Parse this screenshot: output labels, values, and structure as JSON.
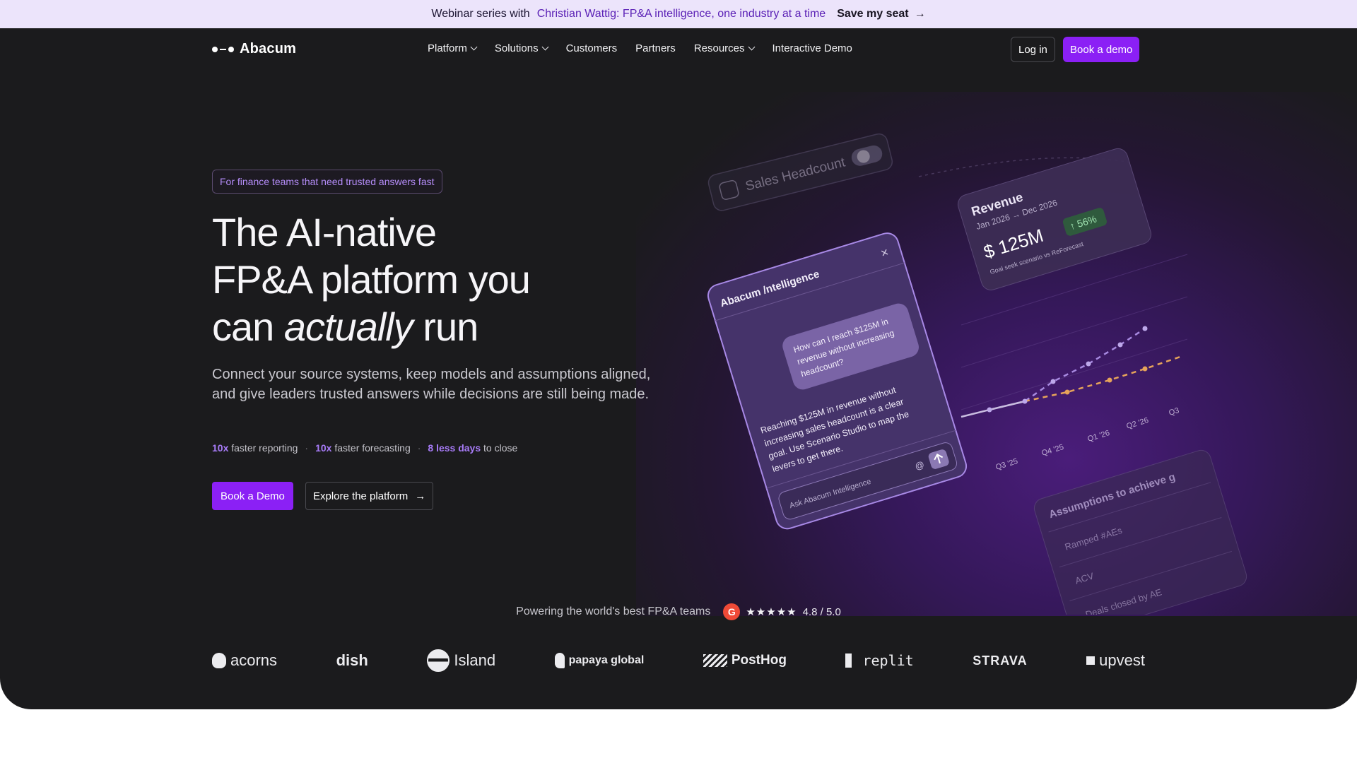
{
  "announcement": {
    "lead": "Webinar series with",
    "highlight": "Christian Wattig: FP&A intelligence, one industry at a time",
    "cta": "Save my seat",
    "cta_arrow": "→"
  },
  "nav": {
    "logo": "Abacum",
    "items": [
      {
        "label": "Platform",
        "dropdown": true
      },
      {
        "label": "Solutions",
        "dropdown": true
      },
      {
        "label": "Customers",
        "dropdown": false
      },
      {
        "label": "Partners",
        "dropdown": false
      },
      {
        "label": "Resources",
        "dropdown": true
      },
      {
        "label": "Interactive Demo",
        "dropdown": false
      }
    ],
    "login": "Log in",
    "book_demo": "Book a demo"
  },
  "hero": {
    "pill": "For finance teams that need trusted answers fast",
    "headline_line1": "The AI-native",
    "headline_line2": "FP&A platform you",
    "headline_line3_pre": "can ",
    "headline_line3_em": "actually",
    "headline_line3_post": " run",
    "subtext": "Connect your source systems, keep models and assumptions aligned, and give leaders trusted answers while decisions are still being made.",
    "stats": [
      {
        "value": "10x",
        "label": "faster reporting"
      },
      {
        "value": "10x",
        "label": "faster forecasting"
      },
      {
        "value": "8 less days",
        "label": "to close"
      }
    ],
    "stats_separator": "·",
    "primary_cta": "Book a Demo",
    "secondary_cta": "Explore the platform",
    "secondary_arrow": "→"
  },
  "illustration": {
    "toggle_label": "Sales Headcount",
    "revenue_card": {
      "title": "Revenue",
      "range": "Jan 2026 → Dec 2026",
      "value": "$ 125M",
      "change": "↑ 56%",
      "note": "Goal seek scenario vs ReForecast"
    },
    "chat": {
      "title": "Abacum /ntelligence",
      "close": "×",
      "question_lines": [
        "How can I reach $125M in",
        "revenue without increasing",
        "headcount?"
      ],
      "answer_lines": [
        "Reaching $125M in revenue without",
        "increasing sales headcount is a clear",
        "goal. Use Scenario Studio to map the",
        "levers to get there."
      ],
      "input_placeholder": "Ask Abacum Intelligence",
      "at": "@"
    },
    "axis_labels": [
      "Q3 '25",
      "Q4 '25",
      "Q1 '26",
      "Q2 '26",
      "Q3"
    ],
    "assumptions": {
      "title": "Assumptions to achieve g",
      "rows": [
        "Ramped #AEs",
        "ACV",
        "Deals closed by AE"
      ]
    }
  },
  "proof": {
    "text": "Powering the world's best FP&A teams",
    "g2": "G",
    "stars": "★★★★★",
    "rating": "4.8 / 5.0"
  },
  "logos": [
    {
      "name": "acorns",
      "icon": "acorns-icon"
    },
    {
      "name": "dish",
      "icon": "dish-logo"
    },
    {
      "name": "Island",
      "icon": "island-icon"
    },
    {
      "name": "papaya global",
      "icon": "papaya-icon"
    },
    {
      "name": "PostHog",
      "icon": "posthog-icon"
    },
    {
      "name": "replit",
      "icon": "replit-icon"
    },
    {
      "name": "STRAVA",
      "icon": "strava-logo"
    },
    {
      "name": "upvest",
      "icon": "upvest-icon"
    }
  ],
  "colors": {
    "accent": "#8b20f5",
    "announce_bg": "#ece4fb",
    "dark_bg": "#1b1b1d",
    "highlight_text": "#a77bf7"
  }
}
